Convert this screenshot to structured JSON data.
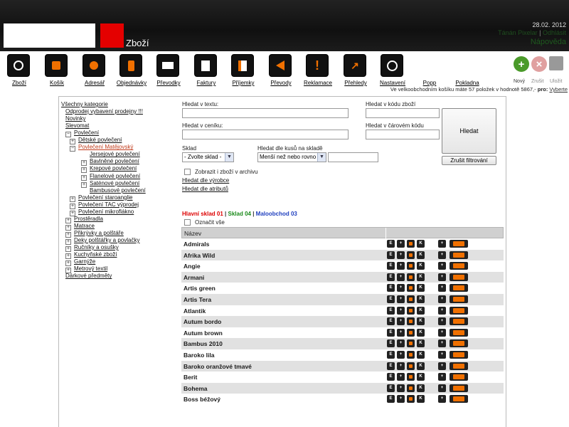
{
  "header": {
    "page_title": "Zboží",
    "date": "28.02. 2012",
    "user_name": "Tánán Pixelar",
    "logout": "Odhlásit",
    "help": "Nápověda"
  },
  "toolbar": [
    {
      "label": "Zboží",
      "icon": "refresh-icon"
    },
    {
      "label": "Košík",
      "icon": "cart-icon"
    },
    {
      "label": "Adresář",
      "icon": "person-icon"
    },
    {
      "label": "Objednávky",
      "icon": "phone-icon"
    },
    {
      "label": "Převodky",
      "icon": "envelope-icon"
    },
    {
      "label": "Faktury",
      "icon": "document-icon"
    },
    {
      "label": "Příjemky",
      "icon": "receipt-icon"
    },
    {
      "label": "Převody",
      "icon": "transfer-icon"
    },
    {
      "label": "Reklamace",
      "icon": "warning-icon"
    },
    {
      "label": "Přehledy",
      "icon": "chart-icon"
    },
    {
      "label": "Nastavení",
      "icon": "globe-icon"
    },
    {
      "label": "Popp",
      "icon": ""
    },
    {
      "label": "Pokladna",
      "icon": ""
    }
  ],
  "actions": {
    "new": "Nový",
    "cancel": "Zrušit",
    "save": "Uložit"
  },
  "status": {
    "text": "Ve velkoobchodním košíku máte 57 položek v hodnotě 5867,- ",
    "pro_label": "pro:",
    "choose": "Vyberte"
  },
  "tree": [
    {
      "label": "Všechny kategorie",
      "level": 0,
      "toggle": ""
    },
    {
      "label": "Odprodej vybavení prodejny !!!",
      "level": 1,
      "toggle": ""
    },
    {
      "label": "Novinky",
      "level": 1,
      "toggle": ""
    },
    {
      "label": "Slevomat",
      "level": 1,
      "toggle": ""
    },
    {
      "label": "Povlečení",
      "level": 1,
      "toggle": "−"
    },
    {
      "label": "Dětské povlečení",
      "level": 2,
      "toggle": "+"
    },
    {
      "label": "Povlečení Matějovský",
      "level": 2,
      "toggle": "−",
      "active": true
    },
    {
      "label": "Jersejové povlečení",
      "level": 3,
      "toggle": ""
    },
    {
      "label": "Bavlněné povlečení",
      "level": 3,
      "toggle": "+"
    },
    {
      "label": "Krepové povlečení",
      "level": 3,
      "toggle": "+"
    },
    {
      "label": "Flanelové povlečení",
      "level": 3,
      "toggle": "+"
    },
    {
      "label": "Saténové povlečení",
      "level": 3,
      "toggle": "+"
    },
    {
      "label": "Bambusové povlečení",
      "level": 3,
      "toggle": ""
    },
    {
      "label": "Povlečení staroanglie",
      "level": 2,
      "toggle": "+"
    },
    {
      "label": "Povlečení TAC výprodej",
      "level": 2,
      "toggle": "+"
    },
    {
      "label": "Povlečení mikroflákno",
      "level": 2,
      "toggle": "+"
    },
    {
      "label": "Prostěradla",
      "level": 1,
      "toggle": "+"
    },
    {
      "label": "Matrace",
      "level": 1,
      "toggle": "+"
    },
    {
      "label": "Přikrývky a polštáře",
      "level": 1,
      "toggle": "+"
    },
    {
      "label": "Deky polštářky a povlačky",
      "level": 1,
      "toggle": "+"
    },
    {
      "label": "Ručníky a osušky",
      "level": 1,
      "toggle": "+"
    },
    {
      "label": "Kuchyňské zboží",
      "level": 1,
      "toggle": "+"
    },
    {
      "label": "Garnýže",
      "level": 1,
      "toggle": "+"
    },
    {
      "label": "Metrový textil",
      "level": 1,
      "toggle": "+"
    },
    {
      "label": "Dárkové předměty",
      "level": 1,
      "toggle": ""
    }
  ],
  "filter": {
    "search_text_label": "Hledat v textu:",
    "search_code_label": "Hledat v kódu zboží",
    "search_price_label": "Hledat v ceníku:",
    "search_barcode_label": "Hledat v čárovém kódu",
    "search_button": "Hledat",
    "reset_button": "Zrušit filtrování",
    "warehouse_label": "Sklad",
    "warehouse_value": "- Zvolte sklad -",
    "count_label": "Hledat dle kusů na skladě",
    "count_value": "Menší než nebo rovno",
    "archive_label": "Zobrazit i zboží v archivu",
    "by_manufacturer": "Hledat dle výrobce",
    "by_attributes": "Hledat dle atributů"
  },
  "warehouses": {
    "main": "Hlavní sklad 01",
    "store": "Sklad 04",
    "retail": "Maloobchod 03",
    "sep": " | "
  },
  "table": {
    "select_all": "Označit vše",
    "col_name": "Název",
    "rows": [
      "Admirals",
      "Afrika Wild",
      "Angie",
      "Armani",
      "Artis green",
      "Artis Tera",
      "Atlantik",
      "Autum bordo",
      "Autum brown",
      "Bambus 2010",
      "Baroko lila",
      "Baroko oranžové tmavé",
      "Berit",
      "Bohema",
      "Boss béžový"
    ]
  },
  "colors": {
    "accent_orange": "#f07000",
    "warehouse_main": "#dd0000",
    "warehouse_store": "#1a8a1a",
    "warehouse_retail": "#1f3fbf"
  }
}
